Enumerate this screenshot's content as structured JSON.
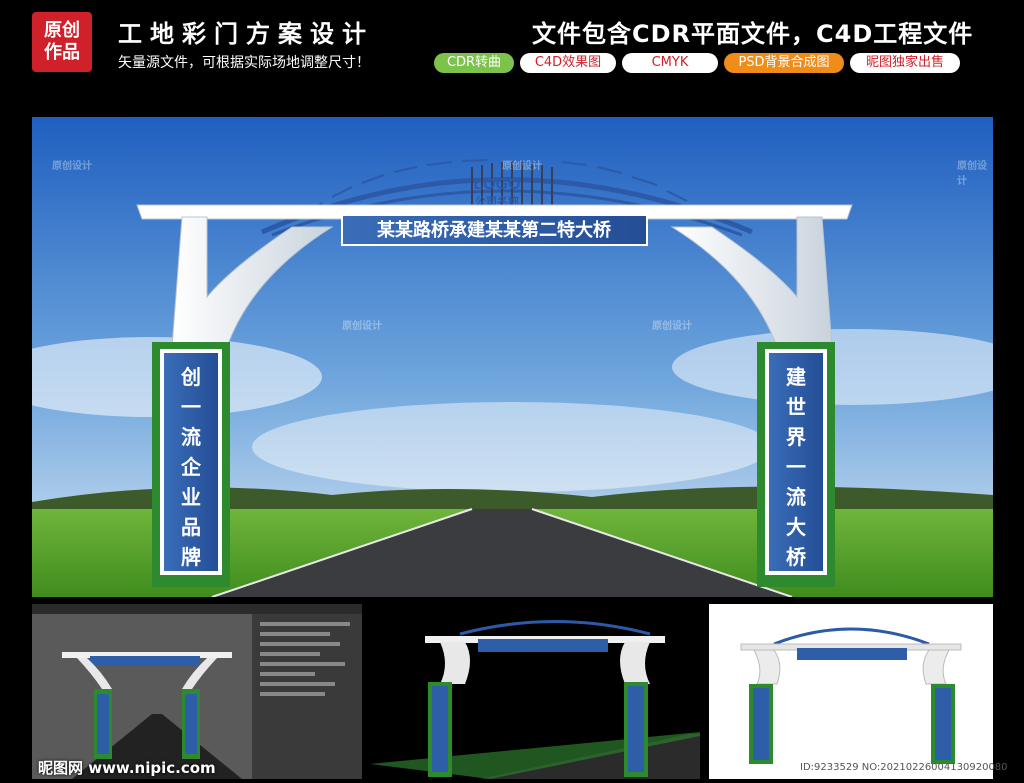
{
  "header": {
    "badge_line1": "原创",
    "badge_line2": "作品",
    "title": "工地彩门方案设计",
    "subtitle": "矢量源文件，可根据实际场地调整尺寸！",
    "files_note": "文件包含CDR平面文件，C4D工程文件",
    "tags": [
      "CDR转曲",
      "C4D效果图",
      "CMYK",
      "PSD背景合成图",
      "昵图独家出售"
    ]
  },
  "gate": {
    "logo": "LOGO",
    "company": "公司名称",
    "banner": "某某路桥承建某某第二特大桥",
    "left_pillar": [
      "创",
      "一",
      "流",
      "企",
      "业",
      "品",
      "牌"
    ],
    "right_pillar": [
      "建",
      "世",
      "界",
      "一",
      "流",
      "大",
      "桥"
    ]
  },
  "watermark": "原创设计",
  "footer": {
    "site": "昵图网 www.nipic.com",
    "id": "ID:9233529 NO:20210226004130920080"
  },
  "colors": {
    "brand_red": "#d0202a",
    "tag_green": "#7cc24b",
    "tag_orange": "#f08c1a",
    "sign_blue": "#2f5ea8",
    "pillar_green": "#2e8a2e"
  }
}
